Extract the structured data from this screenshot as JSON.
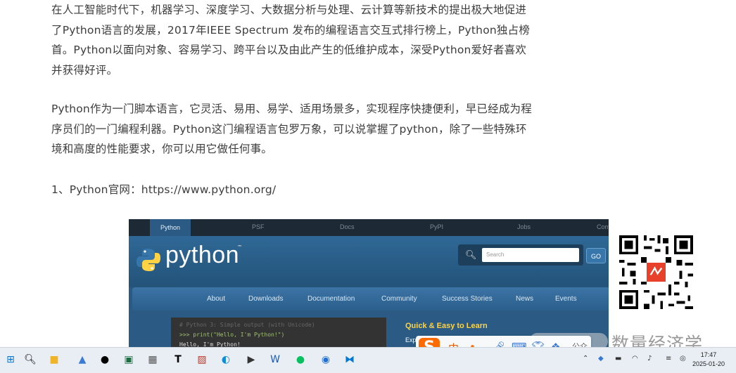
{
  "article": {
    "para1": "在人工智能时代下，机器学习、深度学习、大数据分析与处理、云计算等新技术的提出极大地促进了Python语言的发展，2017年IEEE Spectrum 发布的编程语言交互式排行榜上，Python独占榜首。Python以面向对象、容易学习、跨平台以及由此产生的低维护成本，深受Python爱好者喜欢并获得好评。",
    "para2": "Python作为一门脚本语言，它灵活、易用、易学、适用场景多，实现程序快捷便利，早已经成为程序员们的一门编程利器。Python这门编程语言包罗万象，可以说掌握了python，除了一些特殊环境和高度的性能要求，你可以用它做任何事。",
    "para3": "1、Python官网：https://www.python.org/"
  },
  "python_site": {
    "top_tabs": [
      "Python",
      "PSF",
      "Docs",
      "PyPI",
      "Jobs",
      "Com"
    ],
    "logo_text": "python",
    "tm": "™",
    "search_placeholder": "Search",
    "go_label": "GO",
    "nav": [
      "About",
      "Downloads",
      "Documentation",
      "Community",
      "Success Stories",
      "News",
      "Events"
    ],
    "code_line1": "# Python 3: Simple output (with Unicode)",
    "code_line2": ">>> print(\"Hello, I'm Python!\")",
    "code_line3": "Hello, I'm Python!",
    "quick_title": "Quick & Easy to Learn",
    "quick_text": "Exp"
  },
  "watermark": "数量经济学",
  "ime": {
    "mode": "中",
    "punct": "•,"
  },
  "wechat_pill": "公众号",
  "clock": {
    "time": "17:47",
    "date": "2025-01-20"
  },
  "colors": {
    "python_blue": "#3776ab",
    "python_yellow": "#ffd343",
    "ime_orange": "#ff6a00"
  }
}
